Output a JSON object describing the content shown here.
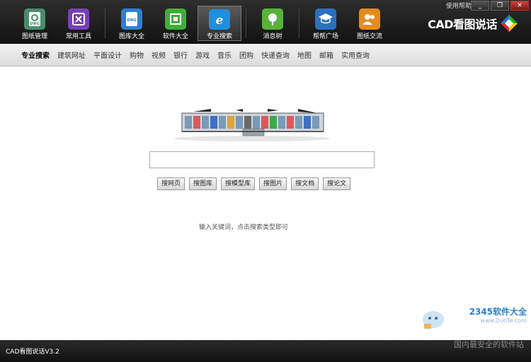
{
  "toolbar": {
    "help": "使用帮助",
    "window_buttons": [
      "_",
      "❐",
      "✕"
    ],
    "tools": [
      {
        "label": "图纸管理",
        "icon": "dwg-file-icon",
        "color": "#4a8c6a"
      },
      {
        "label": "常用工具",
        "icon": "tools-icon",
        "color": "#7a3fb8"
      },
      {
        "label": "图库大全",
        "icon": "dwg-library-icon",
        "color": "#2f7fd1"
      },
      {
        "label": "软件大全",
        "icon": "software-box-icon",
        "color": "#3fae3a"
      },
      {
        "label": "专业搜索",
        "icon": "ie-search-icon",
        "color": "#1f8fe0"
      },
      {
        "label": "消息树",
        "icon": "tree-icon",
        "color": "#59b23a"
      },
      {
        "label": "帮帮广场",
        "icon": "graduation-cap-icon",
        "color": "#2c6fbf"
      },
      {
        "label": "图纸交流",
        "icon": "users-icon",
        "color": "#e58a1f"
      }
    ],
    "active_tool": "专业搜索",
    "logo_text": "CAD看图说话"
  },
  "categories": [
    "专业搜索",
    "建筑网址",
    "平面设计",
    "购物",
    "视频",
    "银行",
    "游戏",
    "音乐",
    "团购",
    "快递查询",
    "地图",
    "邮箱",
    "实用查询"
  ],
  "active_category": "专业搜索",
  "search": {
    "value": "",
    "placeholder": "",
    "buttons": [
      "搜网页",
      "搜图库",
      "搜模型库",
      "搜图片",
      "搜文档",
      "搜论文"
    ],
    "hint": "输入关键词，点击搜索类型即可"
  },
  "watermark": {
    "brand": "2345软件大全",
    "url": "www.DuoTe.com"
  },
  "status": {
    "version": "CAD看图说话V3.2",
    "slogan": "国内最安全的软件站"
  }
}
